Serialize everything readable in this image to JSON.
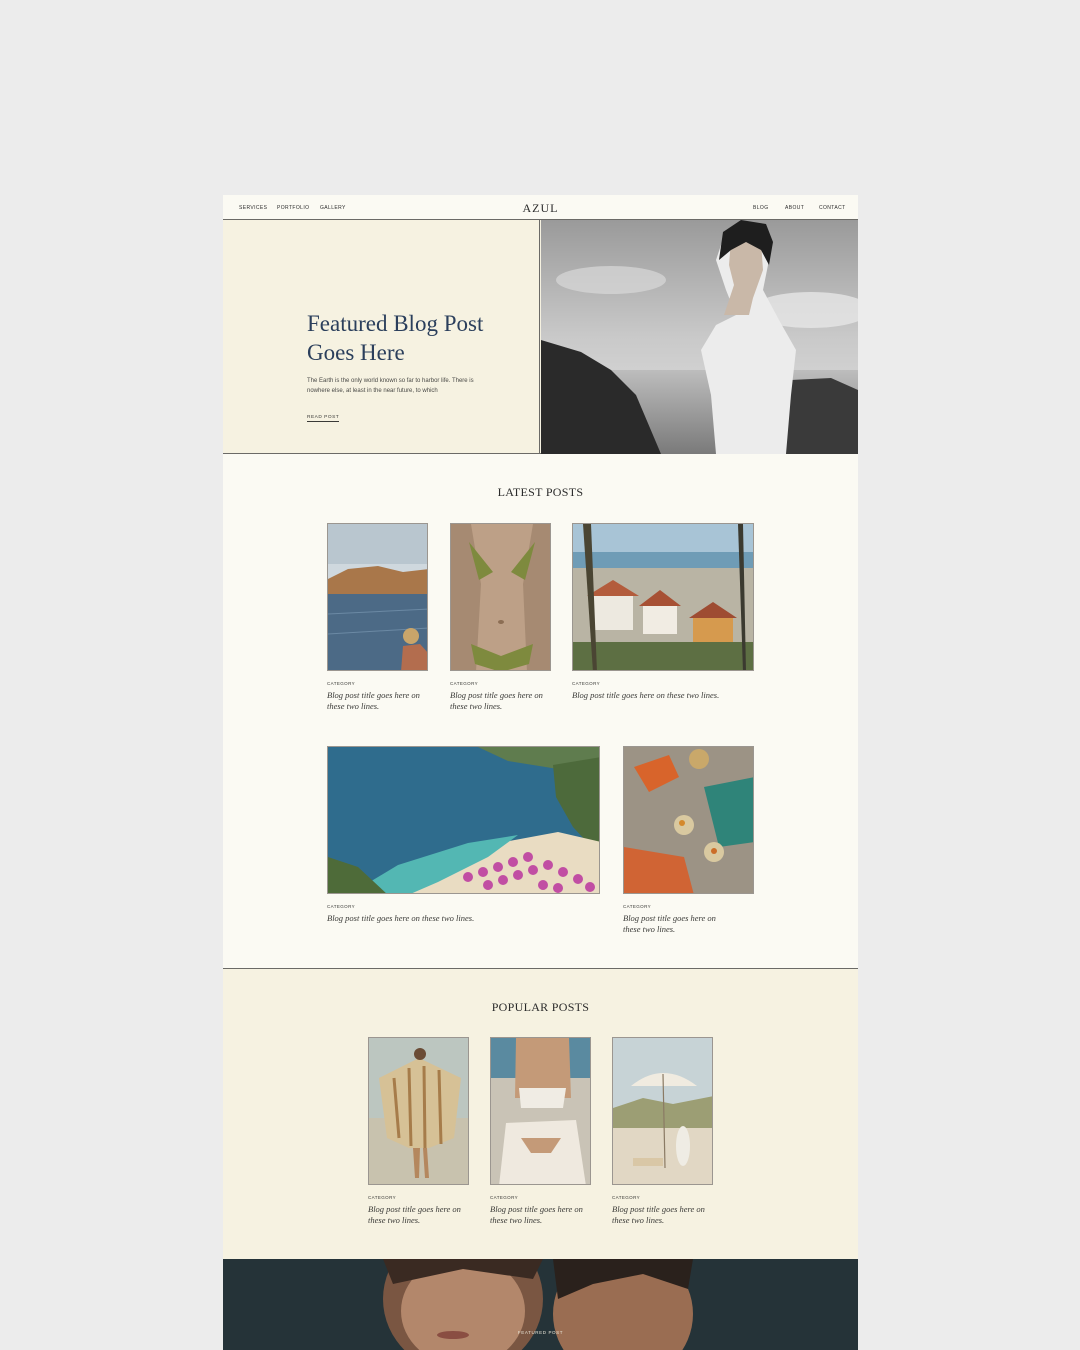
{
  "nav": {
    "left": [
      "SERVICES",
      "PORTFOLIO",
      "GALLERY"
    ],
    "logo": "AZUL",
    "right": [
      "BLOG",
      "ABOUT",
      "CONTACT"
    ]
  },
  "hero": {
    "title": "Featured Blog Post Goes Here",
    "excerpt": "The Earth is the only world known so far to harbor life. There is nowhere else, at least in the near future, to which",
    "link": "READ POST"
  },
  "latest": {
    "heading": "LATEST POSTS",
    "posts": [
      {
        "category": "CATEGORY",
        "title": "Blog post title goes here on these two lines."
      },
      {
        "category": "CATEGORY",
        "title": "Blog post title goes here on these two lines."
      },
      {
        "category": "CATEGORY",
        "title": "Blog post title goes here on these two lines."
      },
      {
        "category": "CATEGORY",
        "title": "Blog post title goes here on these two lines."
      },
      {
        "category": "CATEGORY",
        "title": "Blog post title goes here on these two lines."
      }
    ]
  },
  "popular": {
    "heading": "POPULAR POSTS",
    "posts": [
      {
        "category": "CATEGORY",
        "title": "Blog post title goes here on these two lines."
      },
      {
        "category": "CATEGORY",
        "title": "Blog post title goes here on these two lines."
      },
      {
        "category": "CATEGORY",
        "title": "Blog post title goes here on these two lines."
      }
    ]
  },
  "featured_footer": {
    "label": "FEATURED POST"
  },
  "colors": {
    "cream": "#fbfaf3",
    "beige": "#f6f2e1",
    "navy_title": "#2b3f5c"
  }
}
